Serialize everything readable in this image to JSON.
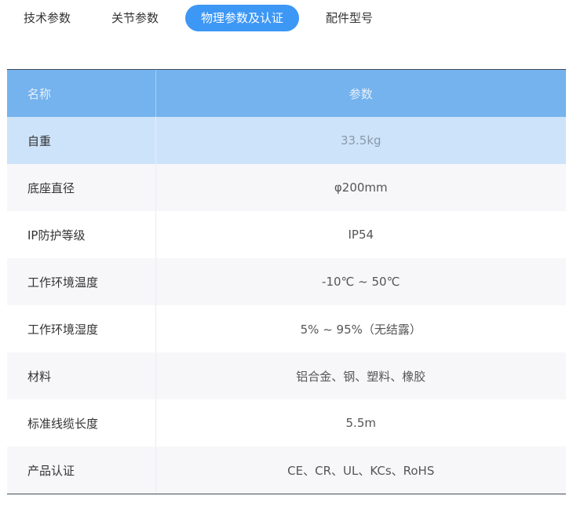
{
  "tabs": [
    {
      "label": "技术参数",
      "active": false
    },
    {
      "label": "关节参数",
      "active": false
    },
    {
      "label": "物理参数及认证",
      "active": true
    },
    {
      "label": "配件型号",
      "active": false
    }
  ],
  "table": {
    "headers": [
      "名称",
      "参数"
    ],
    "rows": [
      {
        "name": "自重",
        "value": "33.5kg"
      },
      {
        "name": "底座直径",
        "value": "φ200mm"
      },
      {
        "name": "IP防护等级",
        "value": "IP54"
      },
      {
        "name": "工作环境温度",
        "value": "-10℃ ~ 50℃"
      },
      {
        "name": "工作环境湿度",
        "value": "5% ~ 95%（无结露）"
      },
      {
        "name": "材料",
        "value": "铝合金、钢、塑料、橡胶"
      },
      {
        "name": "标准线缆长度",
        "value": "5.5m"
      },
      {
        "name": "产品认证",
        "value": "CE、CR、UL、KCs、RoHS"
      }
    ],
    "highlighted_row": 0
  },
  "colors": {
    "accent": "#3d97f5",
    "header_bg": "#75b3ee",
    "highlight_row": "#cde3fa",
    "stripe_row": "#f7f7fa"
  }
}
